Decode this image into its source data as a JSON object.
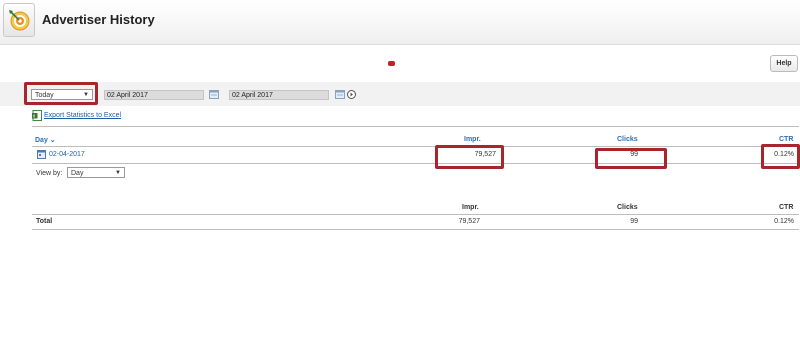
{
  "header": {
    "title": "Advertiser History",
    "icon": "target-arrow-icon"
  },
  "toolbar": {
    "help_label": "Help"
  },
  "filters": {
    "period_selected": "Today",
    "date_from": "02 April 2017",
    "date_to": "02 April 2017",
    "export_label": "Export Statistics to Excel"
  },
  "table": {
    "columns": {
      "day": "Day",
      "impressions": "Impr.",
      "clicks": "Clicks",
      "ctr": "CTR"
    },
    "rows": [
      {
        "day": "02-04-2017",
        "impressions": "79,527",
        "clicks": "99",
        "ctr": "0.12%"
      }
    ],
    "view_by_label": "View by:",
    "view_by_selected": "Day"
  },
  "summary": {
    "columns": {
      "impressions": "Impr.",
      "clicks": "Clicks",
      "ctr": "CTR"
    },
    "total_label": "Total",
    "impressions": "79,527",
    "clicks": "99",
    "ctr": "0.12%"
  },
  "colors": {
    "highlight": "#a8262b",
    "link": "#1f5fa8",
    "column_header": "#2b6fb7"
  }
}
